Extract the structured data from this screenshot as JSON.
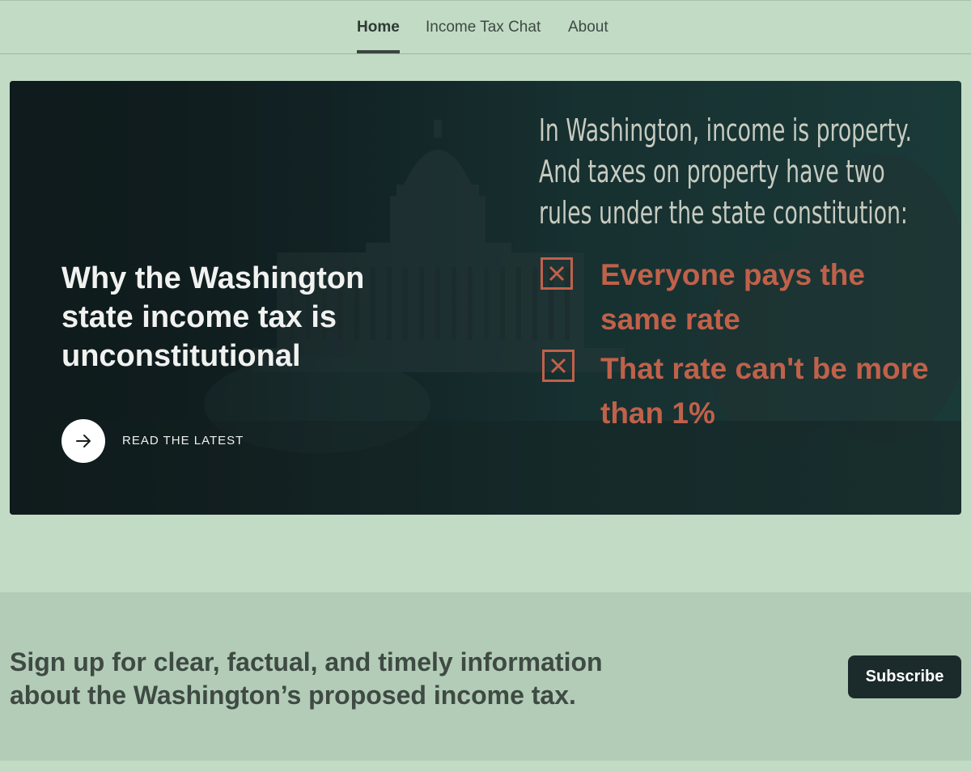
{
  "nav": {
    "items": [
      {
        "label": "Home",
        "active": true
      },
      {
        "label": "Income Tax Chat",
        "active": false
      },
      {
        "label": "About",
        "active": false
      }
    ]
  },
  "hero": {
    "title": "Why the Washington state income tax is unconstitutional",
    "cta_label": "READ THE LATEST",
    "cta_icon": "arrow-right-icon",
    "infographic": {
      "heading": "In Washington, income is property. And taxes on property have two rules under the state constitution:",
      "rules": [
        {
          "icon": "x-box-icon",
          "text": "Everyone pays the same rate"
        },
        {
          "icon": "x-box-icon",
          "text": "That rate can't be more than 1%"
        }
      ]
    }
  },
  "signup": {
    "text": "Sign up for clear, factual, and timely information about the Washington’s proposed income tax.",
    "button_label": "Subscribe"
  },
  "colors": {
    "page_bg": "#c1dbc5",
    "signup_bg": "#b2ccb7",
    "hero_dark": "#132527",
    "accent_rust": "#c0614a",
    "button_dark": "#1b2a2b"
  }
}
